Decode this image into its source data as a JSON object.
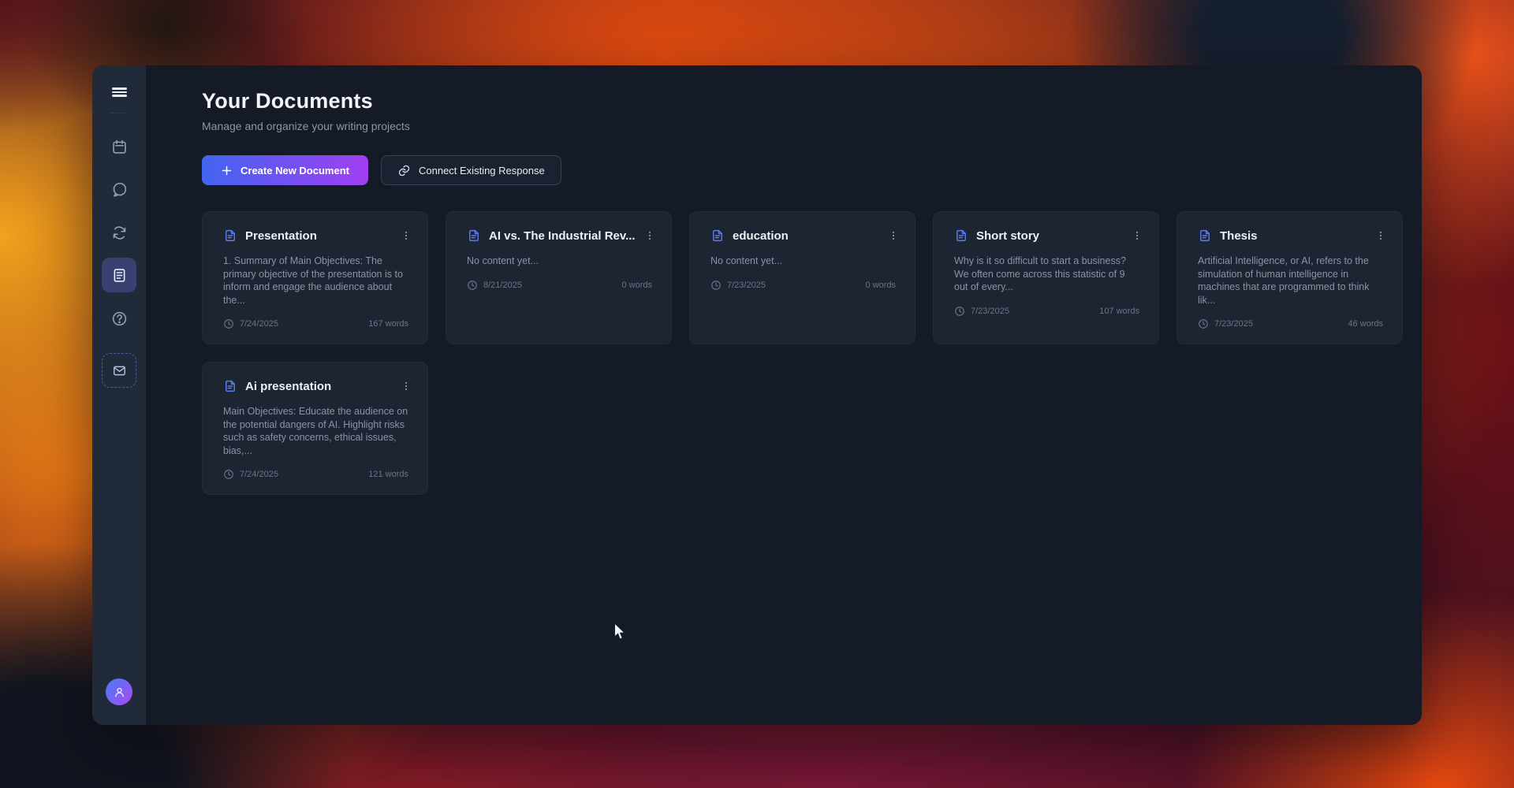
{
  "window": {
    "sidebar": {
      "items": [
        {
          "name": "menu",
          "icon": "hamburger-icon"
        },
        {
          "name": "calendar",
          "icon": "calendar-icon"
        },
        {
          "name": "chat",
          "icon": "chat-icon"
        },
        {
          "name": "sync",
          "icon": "sync-icon"
        },
        {
          "name": "documents",
          "icon": "documents-icon",
          "active": true
        },
        {
          "name": "help",
          "icon": "help-icon"
        },
        {
          "name": "inbox",
          "icon": "mail-icon",
          "dashed": true
        }
      ],
      "avatar_icon": "user-icon"
    },
    "header": {
      "title": "Your Documents",
      "subtitle": "Manage and organize your writing projects"
    },
    "toolbar": {
      "create_button": "Create New Document",
      "connect_button": "Connect Existing Response"
    },
    "cards": [
      {
        "title": "Presentation",
        "preview": "1. Summary of Main Objectives: The primary objective of the presentation is to inform and engage the audience about the...",
        "date": "7/24/2025",
        "words": "167 words"
      },
      {
        "title": "AI vs. The Industrial Rev...",
        "preview": "No content yet...",
        "date": "8/21/2025",
        "words": "0 words"
      },
      {
        "title": "education",
        "preview": "No content yet...",
        "date": "7/23/2025",
        "words": "0 words"
      },
      {
        "title": "Short story",
        "preview": "Why is it so difficult to start a business? We often come across this statistic of 9 out of every...",
        "date": "7/23/2025",
        "words": "107 words"
      },
      {
        "title": "Thesis",
        "preview": "Artificial Intelligence, or AI, refers to the simulation of human intelligence in machines that are programmed to think lik...",
        "date": "7/23/2025",
        "words": "46 words"
      },
      {
        "title": "Ai presentation",
        "preview": "Main Objectives: Educate the audience on the potential dangers of AI. Highlight risks such as safety concerns, ethical issues, bias,...",
        "date": "7/24/2025",
        "words": "121 words"
      }
    ]
  },
  "colors": {
    "accent_gradient_start": "#4165ef",
    "accent_gradient_end": "#a13ff2",
    "active_nav_bg": "#3a4170",
    "window_bg": "#141b27",
    "sidebar_bg": "#202a39",
    "card_bg": "#1d2432",
    "doc_icon_blue": "#5c7cf0"
  }
}
